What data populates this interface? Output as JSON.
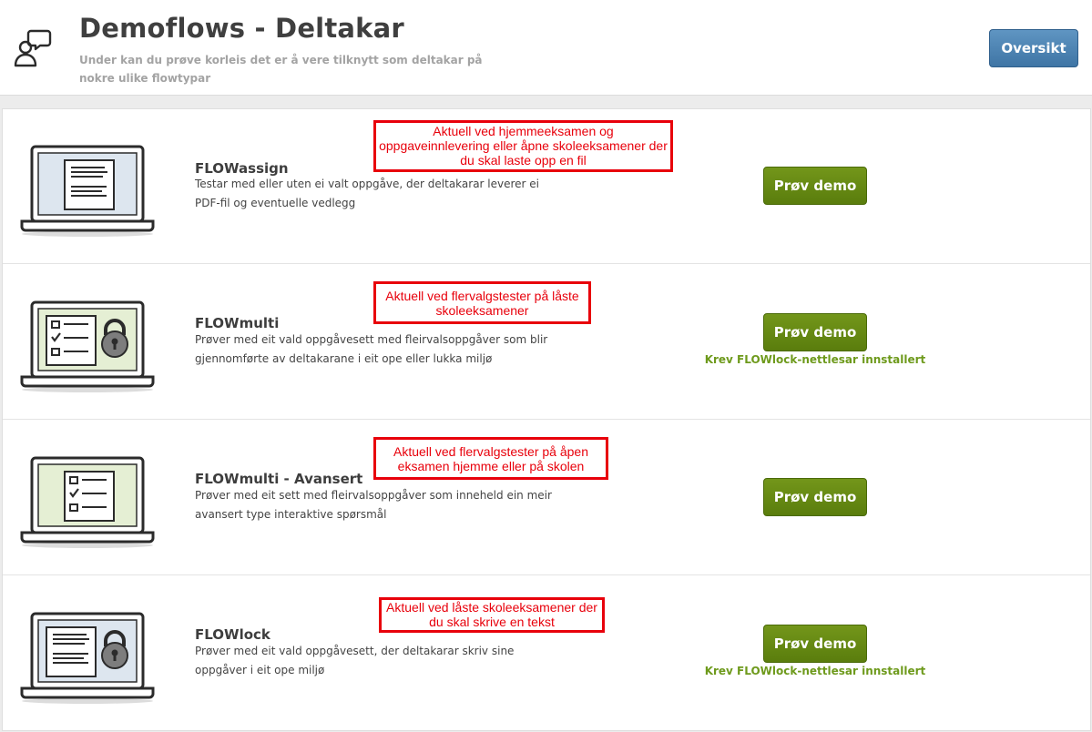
{
  "header": {
    "title": "Demoflows - Deltakar",
    "subtitle": "Under kan du prøve korleis det er å vere tilknytt som deltakar på nokre ulike flowtypar",
    "overview_button": "Oversikt",
    "icon": "speech-bubble-person-icon"
  },
  "colors": {
    "primary_button": "#4a7fb0",
    "demo_button": "#6a8c14",
    "note_text": "#6e9a1c",
    "annotation": "#e8000b"
  },
  "demos": [
    {
      "icon": "laptop-document-icon",
      "title": "FLOWassign",
      "description": "Testar med eller uten ei valt oppgåve, der deltakarar leverer ei PDF-fil og eventuelle vedlegg",
      "button": "Prøv demo",
      "note": "",
      "annotation": "Aktuell ved hjemmeeksamen og oppgaveinnlevering eller åpne skoleeksamener der du skal laste opp en fil"
    },
    {
      "icon": "laptop-checklist-lock-icon",
      "title": "FLOWmulti",
      "description": "Prøver med eit vald oppgåvesett med fleirvalsoppgåver som blir gjennomførte av deltakarane i eit ope eller lukka miljø",
      "button": "Prøv demo",
      "note": "Krev FLOWlock-nettlesar innstallert",
      "annotation": "Aktuell ved flervalgstester på låste skoleeksamener"
    },
    {
      "icon": "laptop-checklist-icon",
      "title": "FLOWmulti - Avansert",
      "description": "Prøver med eit sett med fleirvalsoppgåver som inneheld ein meir avansert type interaktive spørsmål",
      "button": "Prøv demo",
      "note": "",
      "annotation": "Aktuell ved flervalgstester på åpen eksamen hjemme eller på skolen"
    },
    {
      "icon": "laptop-document-lock-icon",
      "title": "FLOWlock",
      "description": "Prøver med eit vald oppgåvesett, der deltakarar skriv sine oppgåver i eit ope miljø",
      "button": "Prøv demo",
      "note": "Krev FLOWlock-nettlesar innstallert",
      "annotation": "Aktuell ved låste skoleeksamener der du skal skrive en tekst"
    }
  ]
}
